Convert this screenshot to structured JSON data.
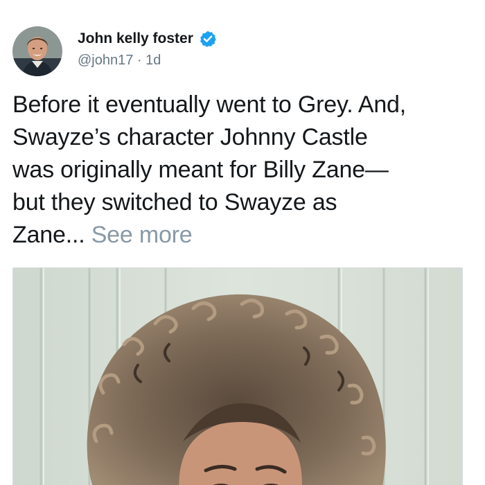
{
  "tweet": {
    "author": {
      "name": "John kelly foster",
      "handle": "@john17",
      "separator": "·",
      "time": "1d",
      "verified": true,
      "avatar_icon": "profile-photo-avatar",
      "verified_icon": "verified-badge-icon"
    },
    "text_lines": [
      "Before it eventually went to Grey. And,",
      "Swayze’s character Johnny Castle",
      "was originally meant for Billy Zane—",
      "but they switched to Swayze as",
      "Zane..."
    ],
    "see_more": "See more",
    "media": {
      "kind": "photo",
      "description_icon": "curly-haired-woman-photo"
    }
  },
  "colors": {
    "name": "#14171a",
    "text": "#14171a",
    "muted": "#657786",
    "see_more": "#8899a6",
    "verified_badge": "#1da1f2",
    "media_border": "#d6dbe0"
  }
}
